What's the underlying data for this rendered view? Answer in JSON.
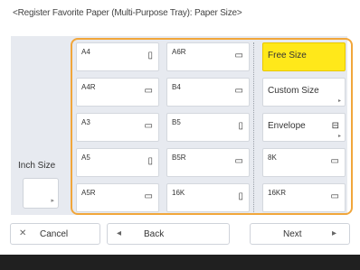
{
  "screen": {
    "title": "<Register Favorite Paper (Multi-Purpose Tray): Paper Size>"
  },
  "inch": {
    "label": "Inch Size"
  },
  "paper_sizes": {
    "col1": [
      "A4",
      "A4R",
      "A3",
      "A5",
      "A5R"
    ],
    "col2": [
      "A6R",
      "B4",
      "B5",
      "B5R",
      "16K"
    ],
    "col3": [
      "Free Size",
      "Custom Size",
      "Envelope",
      "8K",
      "16KR"
    ]
  },
  "selected": "Free Size",
  "buttons": {
    "cancel": "Cancel",
    "back": "Back",
    "next": "Next"
  },
  "colors": {
    "selected_bg": "#ffe81a",
    "focus_frame": "#f1a63b"
  }
}
